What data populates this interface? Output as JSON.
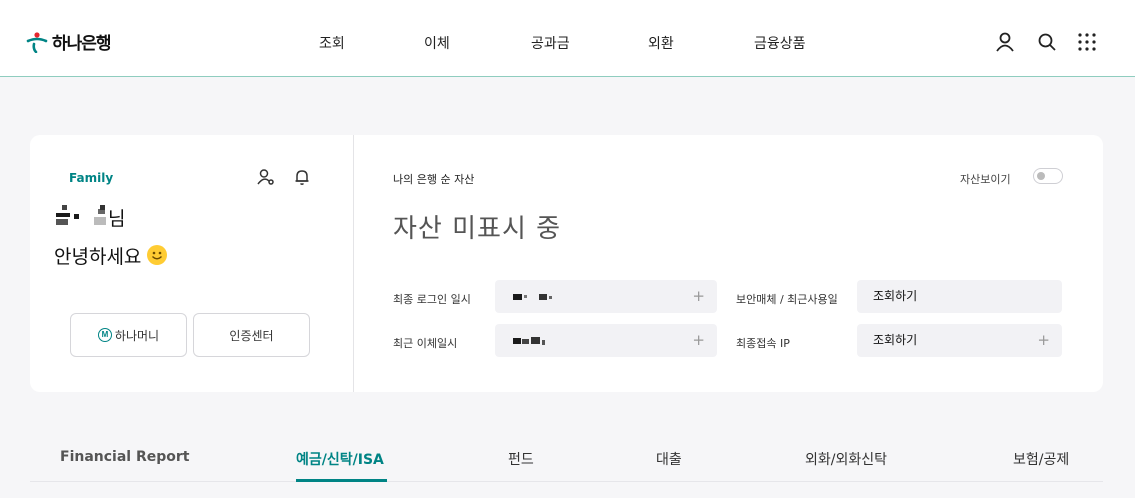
{
  "header": {
    "logo_text": "하나은행",
    "nav": [
      "조회",
      "이체",
      "공과금",
      "외환",
      "금융상품"
    ]
  },
  "profile": {
    "grade": "Family",
    "name_suffix": "님",
    "greeting": "안녕하세요",
    "buttons": {
      "hana_money": "하나머니",
      "hana_money_badge": "M",
      "cert_center": "인증센터"
    }
  },
  "assets": {
    "label": "나의 은행 순 자산",
    "toggle_label": "자산보이기",
    "value": "자산 미표시 중",
    "rows": [
      {
        "left_label": "최종 로그인 일시",
        "right_label": "보안매체 / 최근사용일",
        "right_value": "조회하기"
      },
      {
        "left_label": "최근 이체일시",
        "right_label": "최종접속 IP",
        "right_value": "조회하기"
      }
    ],
    "plus_symbol": "+"
  },
  "tabs": [
    {
      "label": "Financial Report"
    },
    {
      "label": "예금/신탁/ISA",
      "active": true
    },
    {
      "label": "펀드"
    },
    {
      "label": "대출"
    },
    {
      "label": "외화/외화신탁"
    },
    {
      "label": "보험/공제"
    }
  ],
  "colors": {
    "brand": "#008485",
    "accent_red": "#e4262d"
  },
  "icons": {
    "header": [
      "user-icon",
      "search-icon",
      "grid-menu-icon"
    ],
    "profile": [
      "user-settings-icon",
      "bell-icon"
    ]
  }
}
